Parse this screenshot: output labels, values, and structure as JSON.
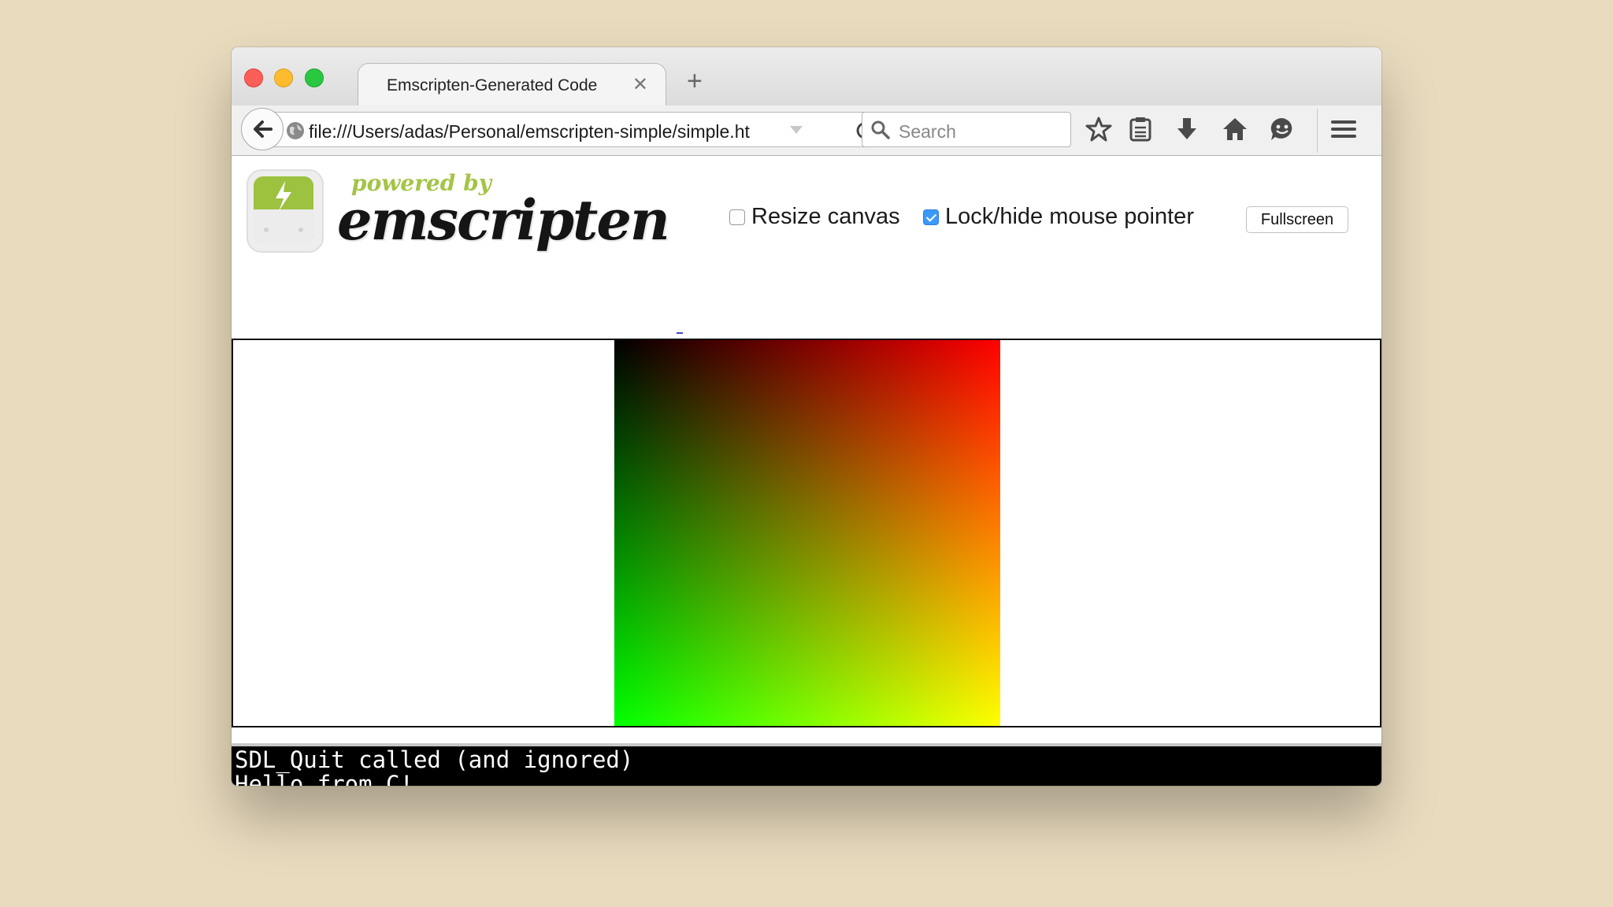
{
  "tab": {
    "title": "Emscripten-Generated Code"
  },
  "url": {
    "value": "file:///Users/adas/Personal/emscripten-simple/simple.ht"
  },
  "search": {
    "placeholder": "Search"
  },
  "logo": {
    "powered": "powered by",
    "name": "emscripten"
  },
  "controls": {
    "resize_label": "Resize canvas",
    "resize_checked": false,
    "lock_label": "Lock/hide mouse pointer",
    "lock_checked": true,
    "fullscreen_label": "Fullscreen"
  },
  "output": {
    "lines": [
      "SDL_Quit called (and ignored)",
      "Hello from C!"
    ]
  },
  "colors": {
    "accent": "#3b99fc",
    "brand": "#a4c446"
  }
}
